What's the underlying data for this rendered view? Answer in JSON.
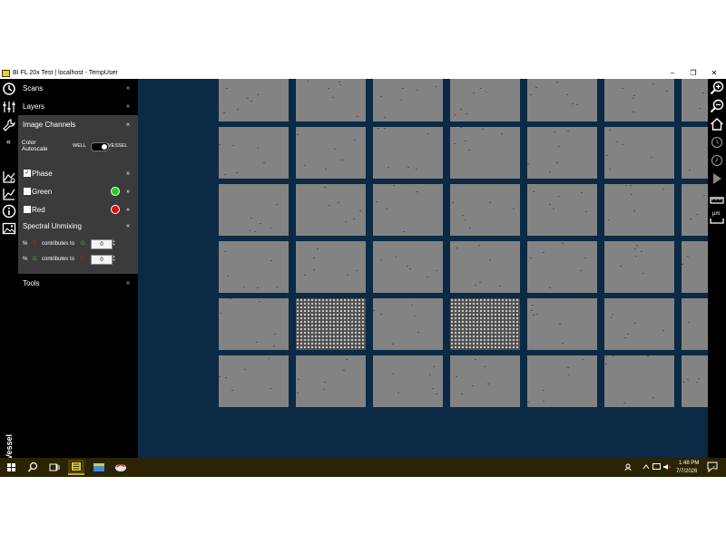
{
  "window": {
    "title": "BI FL 20x Test | localhost - TempUser",
    "minimize": "–",
    "maximize": "❐",
    "close": "✕"
  },
  "sidebar": {
    "scans": "Scans",
    "layers": "Layers",
    "image_channels": "Image Channels",
    "color_autoscale": "Color Autoscale",
    "toggle_left": "WELL",
    "toggle_right": "VESSEL",
    "channels": [
      {
        "name": "Phase",
        "checked": true,
        "color": ""
      },
      {
        "name": "Green",
        "checked": false,
        "color": "#22cc22"
      },
      {
        "name": "Red",
        "checked": false,
        "color": "#e01010"
      }
    ],
    "spectral_unmixing": "Spectral Unmixing",
    "unmix_rows": [
      {
        "pct": "%",
        "src": "R",
        "src_color": "#e01010",
        "text": "contributes to",
        "dst": "G",
        "dst_color": "#22cc22",
        "value": "0"
      },
      {
        "pct": "%",
        "src": "G",
        "src_color": "#22cc22",
        "text": "contributes to",
        "dst": "R",
        "dst_color": "#e01010",
        "value": "0"
      }
    ],
    "tools": "Tools",
    "collapse": "«"
  },
  "left_strip": {
    "vessel_label": "Vessel"
  },
  "right_toolbar": {
    "um_label": "µm"
  },
  "taskbar": {
    "time": "1:48 PM",
    "date": "7/7/2026",
    "notification_count": "4"
  },
  "colors": {
    "viewer_bg": "#0a2a45",
    "panel_bg": "#3b3b3b",
    "taskbar_bg": "#2a2404"
  }
}
